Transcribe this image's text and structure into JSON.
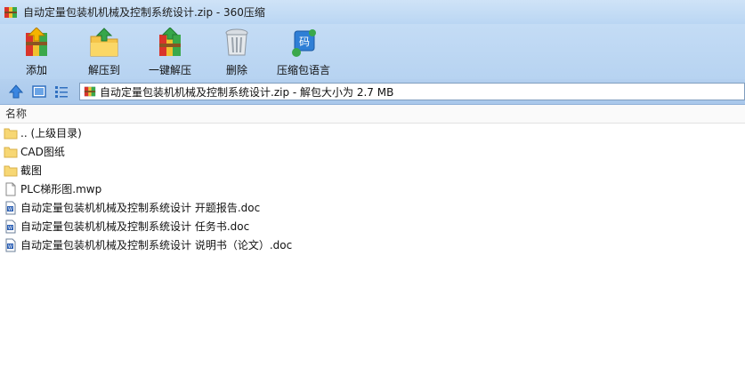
{
  "window": {
    "title": "自动定量包装机机械及控制系统设计.zip - 360压缩"
  },
  "toolbar": {
    "add_label": "添加",
    "extract_to_label": "解压到",
    "one_click_extract_label": "一键解压",
    "delete_label": "删除",
    "language_label": "压缩包语言"
  },
  "addressbar": {
    "path_text": "自动定量包装机机械及控制系统设计.zip - 解包大小为 2.7 MB"
  },
  "list": {
    "column_name": "名称",
    "items": [
      {
        "name": ".. (上级目录)",
        "icon": "folder-icon"
      },
      {
        "name": "CAD图纸",
        "icon": "folder-icon"
      },
      {
        "name": "截图",
        "icon": "folder-icon"
      },
      {
        "name": "PLC梯形图.mwp",
        "icon": "file-icon"
      },
      {
        "name": "自动定量包装机机械及控制系统设计 开题报告.doc",
        "icon": "word-doc-icon"
      },
      {
        "name": "自动定量包装机机械及控制系统设计 任务书.doc",
        "icon": "word-doc-icon"
      },
      {
        "name": "自动定量包装机机械及控制系统设计 说明书（论文）.doc",
        "icon": "word-doc-icon"
      }
    ]
  }
}
